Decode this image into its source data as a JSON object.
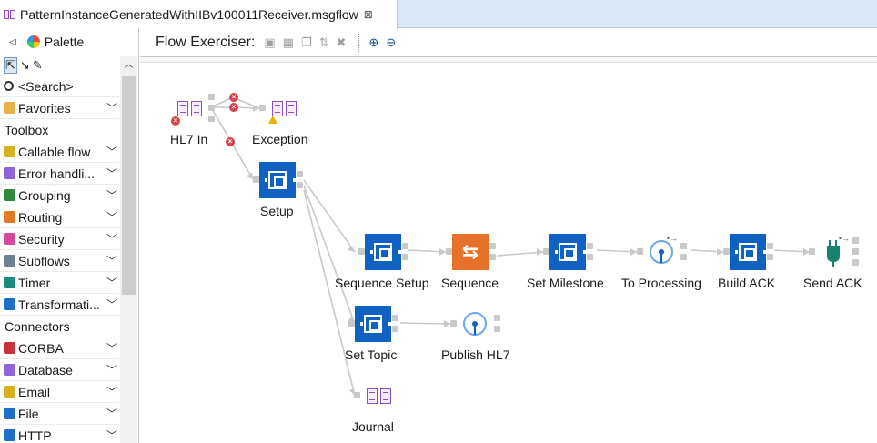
{
  "editor_tab": {
    "title": "PatternInstanceGeneratedWithIIBv100011Receiver.msgflow",
    "close": "⊠"
  },
  "palette": {
    "title": "Palette",
    "search_placeholder": "<Search>",
    "favorites": "Favorites",
    "toolbox_header": "Toolbox",
    "toolbox_items": [
      {
        "label": "Callable flow",
        "color": "#d8b320"
      },
      {
        "label": "Error handli...",
        "color": "#8e65d8"
      },
      {
        "label": "Grouping",
        "color": "#2e8b3d"
      },
      {
        "label": "Routing",
        "color": "#e07a24"
      },
      {
        "label": "Security",
        "color": "#d8479a"
      },
      {
        "label": "Subflows",
        "color": "#6e7f8f"
      },
      {
        "label": "Timer",
        "color": "#1a8b7a"
      },
      {
        "label": "Transformati...",
        "color": "#1f6fc7"
      }
    ],
    "connectors_header": "Connectors",
    "connector_items": [
      {
        "label": "CORBA",
        "color": "#c9323a"
      },
      {
        "label": "Database",
        "color": "#8e65d8"
      },
      {
        "label": "Email",
        "color": "#d8b320"
      },
      {
        "label": "File",
        "color": "#1f6fc7"
      },
      {
        "label": "HTTP",
        "color": "#1f6fc7"
      }
    ]
  },
  "toolbar": {
    "label": "Flow Exerciser:"
  },
  "nodes": {
    "hl7_in": "HL7 In",
    "exception": "Exception",
    "setup": "Setup",
    "sequence_setup": "Sequence Setup",
    "sequence": "Sequence",
    "set_milestone": "Set Milestone",
    "to_processing": "To Processing",
    "build_ack": "Build ACK",
    "send_ack": "Send ACK",
    "set_topic": "Set Topic",
    "publish_hl7": "Publish HL7",
    "journal": "Journal"
  },
  "colors": {
    "compute": "#0f62c1",
    "sequence": "#e8712a",
    "mq_node": "#6aa7e8",
    "error_marker": "#d9434b",
    "warning_marker": "#e3b100",
    "connection": "#c9c9c9"
  }
}
